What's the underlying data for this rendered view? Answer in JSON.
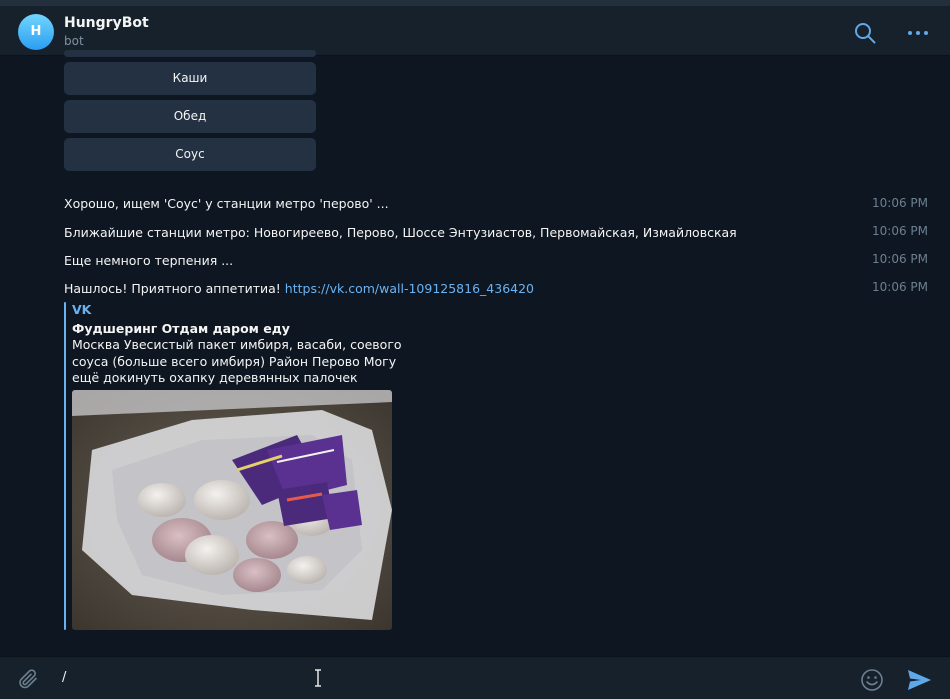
{
  "header": {
    "avatar_letter": "H",
    "title": "HungryBot",
    "subtitle": "bot"
  },
  "keyboard": {
    "buttons": [
      "Каши",
      "Обед",
      "Соус"
    ]
  },
  "messages": [
    {
      "text": "Хорошо, ищем 'Соус' у станции метро 'перово' ...",
      "time": "10:06 PM"
    },
    {
      "text": "Ближайшие станции метро: Новогиреево, Перово, Шоссе Энтузиастов, Первомайская, Измайловская",
      "time": "10:06 PM"
    },
    {
      "text": "Еще немного терпения ...",
      "time": "10:06 PM"
    },
    {
      "text": "Нашлось! Приятного аппетитиа!",
      "link": "https://vk.com/wall-109125816_436420",
      "time": "10:06 PM"
    }
  ],
  "link_preview": {
    "site": "VK",
    "title": "Фудшеринг Отдам даром еду",
    "description": "Москва Увесистый пакет имбиря, васаби, соевого соуса (больше всего имбиря) Район Перово Могу ещё докинуть охапку деревянных палочек"
  },
  "composer": {
    "input_value": "/"
  },
  "colors": {
    "background": "#0e1621",
    "header": "#17212b",
    "keyboard_button": "#243143",
    "accent": "#6ab3f3",
    "time": "#6d7f8f"
  },
  "icons": [
    "search-icon",
    "more-icon",
    "attach-icon",
    "emoji-icon",
    "send-icon"
  ]
}
